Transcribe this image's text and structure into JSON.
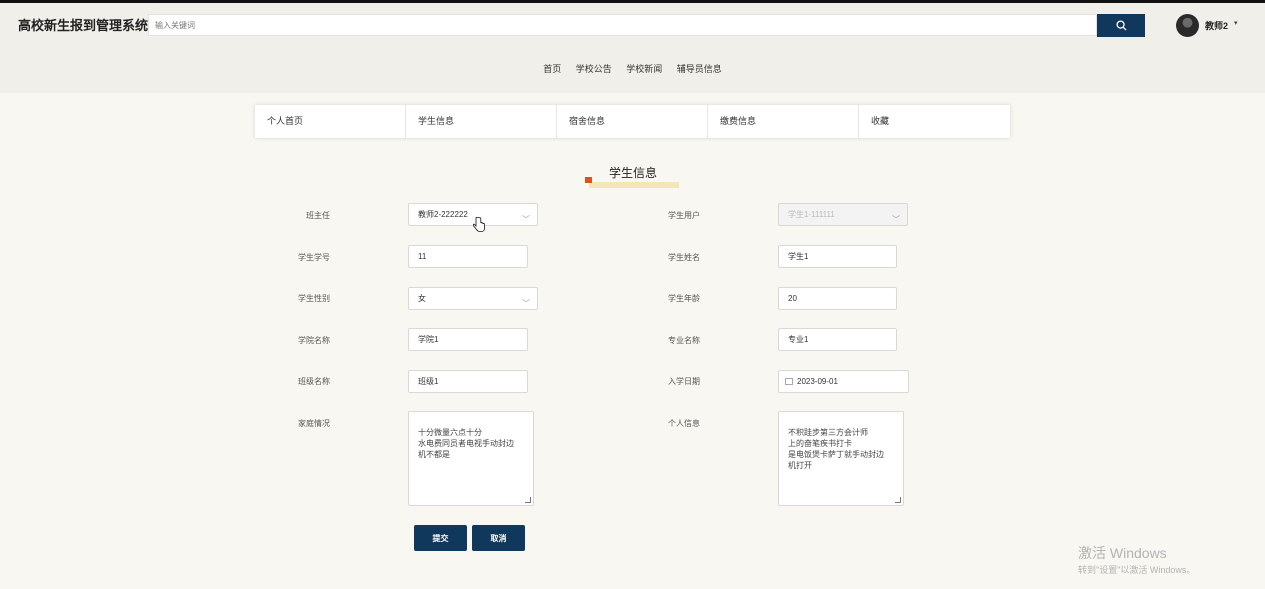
{
  "header": {
    "app_title": "高校新生报到管理系统",
    "search_placeholder": "输入关键词",
    "search_icon": "search-icon",
    "user_name": "教师2",
    "user_caret": "▾"
  },
  "nav": [
    "首页",
    "学校公告",
    "学校新闻",
    "辅导员信息"
  ],
  "tabs": [
    "个人首页",
    "学生信息",
    "宿舍信息",
    "缴费信息",
    "收藏"
  ],
  "section_title": "学生信息",
  "form": {
    "banzhuren": {
      "label": "班主任",
      "value": "教师2-222222"
    },
    "xuesheng_yonghu": {
      "label": "学生用户",
      "value": "学生1-111111"
    },
    "xuesheng_xuehao": {
      "label": "学生学号",
      "value": "11"
    },
    "xuesheng_xingming": {
      "label": "学生姓名",
      "value": "学生1"
    },
    "xuesheng_xingbie": {
      "label": "学生性别",
      "value": "女"
    },
    "xuesheng_nianling": {
      "label": "学生年龄",
      "value": "20"
    },
    "xueyuan_mingcheng": {
      "label": "学院名称",
      "value": "学院1"
    },
    "zhuanye_mingcheng": {
      "label": "专业名称",
      "value": "专业1"
    },
    "banji_mingcheng": {
      "label": "班级名称",
      "value": "班级1"
    },
    "ruxue_riqi": {
      "label": "入学日期",
      "value": "2023-09-01"
    },
    "jiating_qingkuang": {
      "label": "家庭情况",
      "value": " 十分微量六点十分\n水电费同员者电视手动封边\n机不都是"
    },
    "geren_xinxi": {
      "label": "个人信息",
      "value": "不积跬步第三方会计师\n上的奋笔疾书打卡\n是电饭煲卡萨丁就手动封边\n机打开"
    }
  },
  "buttons": {
    "submit": "提交",
    "cancel": "取消"
  },
  "watermark": {
    "line1": "激活 Windows",
    "line2": "转到\"设置\"以激活 Windows。"
  },
  "colors": {
    "accent": "#10375c",
    "header_bg": "#f1efe9",
    "page_bg": "#f8f7f2",
    "title_flag": "#d9541e"
  }
}
